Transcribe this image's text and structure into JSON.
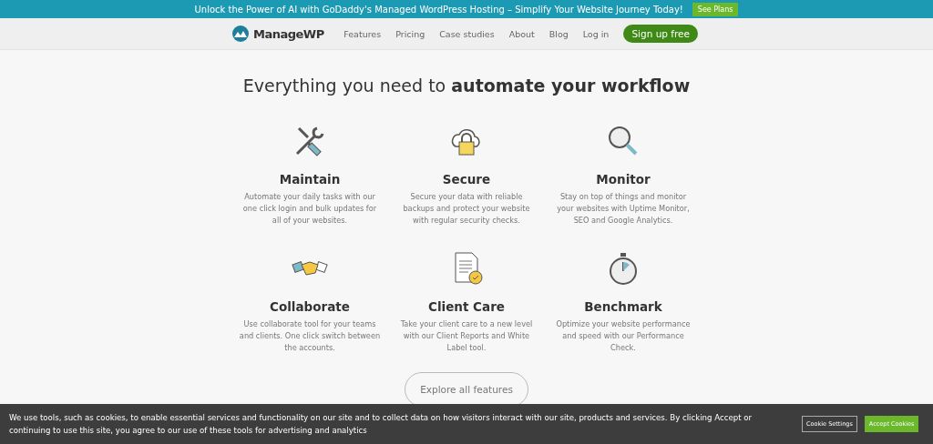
{
  "promo_banner": {
    "text": "Unlock the Power of AI with GoDaddy's Managed WordPress Hosting – Simplify Your Website Journey Today!",
    "button": "See Plans"
  },
  "nav": {
    "logo": "ManageWP",
    "links": [
      "Features",
      "Pricing",
      "Case studies",
      "About",
      "Blog",
      "Log in"
    ],
    "cta": "Sign up free"
  },
  "heading": "Everything you need to **automate your workflow**",
  "features": [
    {
      "title": "Maintain",
      "text": "Automate your daily tasks with our one click login and bulk updates for all of your websites."
    },
    {
      "title": "Secure",
      "text": "Secure your data with reliable backups and protect your website with regular security checks."
    },
    {
      "title": "Monitor",
      "text": "Stay on top of things and monitor your websites with Uptime Monitor, SEO and Google Analytics."
    },
    {
      "title": "Collaborate",
      "text": "Use collaborate tool for your teams and clients. One click switch between the accounts."
    },
    {
      "title": "Client Care",
      "text": "Take your client care to a new level with our Client Reports and White Label tool."
    },
    {
      "title": "Benchmark",
      "text": "Optimize your website performance and speed with our Performance Check."
    }
  ],
  "explore_button": "Explore all features",
  "cookie_bar": {
    "text": "We use tools, such as cookies, to enable essential services and functionality on our site and to collect data on how visitors interact with our site, products and services. By clicking Accept or continuing to use this site, you agree to our use of these tools for advertising and analytics",
    "settings_button": "Cookie Settings",
    "accept_button": "Accept Cookies"
  }
}
